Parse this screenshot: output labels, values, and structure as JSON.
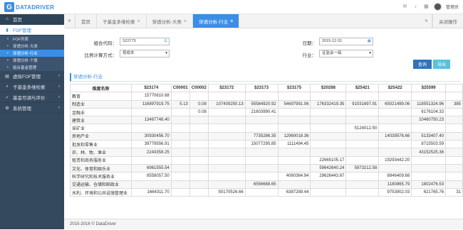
{
  "app": {
    "logo_letter": "G",
    "logo_text": "DATADRIVER",
    "user": "管理员"
  },
  "sidebar": {
    "items": [
      {
        "label": "首页",
        "icon": "home-icon"
      },
      {
        "label": "FOF管理",
        "icon": "chart-icon"
      },
      {
        "label": "虚拟FOF管理",
        "icon": "folder-icon"
      },
      {
        "label": "子基金多维检索",
        "icon": "search-icon"
      },
      {
        "label": "基金尽调与评价",
        "icon": "check-icon"
      },
      {
        "label": "系统管理",
        "icon": "gear-icon"
      }
    ],
    "subitems": [
      "FOF列表",
      "穿透分析-大类",
      "穿透分析-行业",
      "穿透分析-个股",
      "组合基金管理"
    ]
  },
  "tabs": {
    "items": [
      {
        "label": "首页"
      },
      {
        "label": "子基金多维检索"
      },
      {
        "label": "穿透分析-大类"
      },
      {
        "label": "穿透分析-行业"
      }
    ],
    "close_ops": "关闭操作"
  },
  "form": {
    "portfolio_label": "组合代码：",
    "portfolio_value": "S22775",
    "method_label": "比例计算方式：",
    "method_value": "按成本",
    "date_label": "日期：",
    "date_value": "2015-12-31",
    "industry_label": "行业：",
    "industry_value": "证监会一级",
    "query_button": "查询",
    "export_button": "导出"
  },
  "section_title": "穿透分析-行业",
  "table": {
    "columns": [
      "维度名称",
      "$23174",
      "C00001",
      "C00002",
      "$23172",
      "$23173",
      "$23175",
      "$20288",
      "$25421",
      "$25422",
      "$25599",
      ""
    ],
    "rows": [
      [
        "教育",
        "15770610.68",
        "",
        "",
        "",
        "",
        "",
        "",
        "",
        "",
        "",
        ""
      ],
      [
        "制造业",
        "116897919.75",
        "5.13",
        "0.08",
        "107409250.13",
        "55584920.92",
        "54697991.06",
        "176332419.35",
        "91031697.91",
        "65021499.06",
        "118551324.96",
        "385"
      ],
      [
        "金融业",
        "",
        "",
        "0.08",
        "",
        "21603990.41",
        "",
        "",
        "",
        "",
        "6176104.33",
        ""
      ],
      [
        "建筑业",
        "13467748.40",
        "",
        "",
        "",
        "",
        "",
        "",
        "",
        "",
        "10460750.23",
        ""
      ],
      [
        "采矿业",
        "",
        "",
        "",
        "",
        "",
        "",
        "",
        "5124012.50",
        "",
        "",
        ""
      ],
      [
        "房地产业",
        "30930456.70",
        "",
        "",
        "",
        "7735286.35",
        "12960018.36",
        "",
        "",
        "14039576.66",
        "5133407.40",
        ""
      ],
      [
        "批发和零售业",
        "39779556.91",
        "",
        "",
        "",
        "15077295.85",
        "1111494.45",
        "",
        "",
        "",
        "8715503.59",
        ""
      ],
      [
        "农、林、牧、渔业",
        "2243358.25",
        "",
        "",
        "",
        "",
        "",
        "",
        "",
        "",
        "43152525.36",
        ""
      ],
      [
        "租赁和商务服务业",
        "",
        "",
        "",
        "",
        "",
        "",
        "22665105.17",
        "",
        "19293442.20",
        "",
        ""
      ],
      [
        "文化、体育和娱乐业",
        "6961555.54",
        "",
        "",
        "",
        "",
        "",
        "59642640.24",
        "5973212.58",
        "",
        "",
        ""
      ],
      [
        "科学研究和技术服务业",
        "8558057.50",
        "",
        "",
        "",
        "",
        "4060364.94",
        "29626443.67",
        "",
        "8946409.68",
        "",
        ""
      ],
      [
        "交通运输、仓储和邮政业",
        "",
        "",
        "",
        "",
        "6556688.65",
        "",
        "",
        "",
        "1180865.79",
        "1802476.53",
        ""
      ],
      [
        "水利、环境和公共设施管理业",
        "1664311.70",
        "",
        "",
        "50170526.66",
        "",
        "6387289.44",
        "",
        "",
        "9753902.03",
        "621765.76",
        "31"
      ]
    ]
  },
  "footer": "2015-2016 © DataDriver"
}
